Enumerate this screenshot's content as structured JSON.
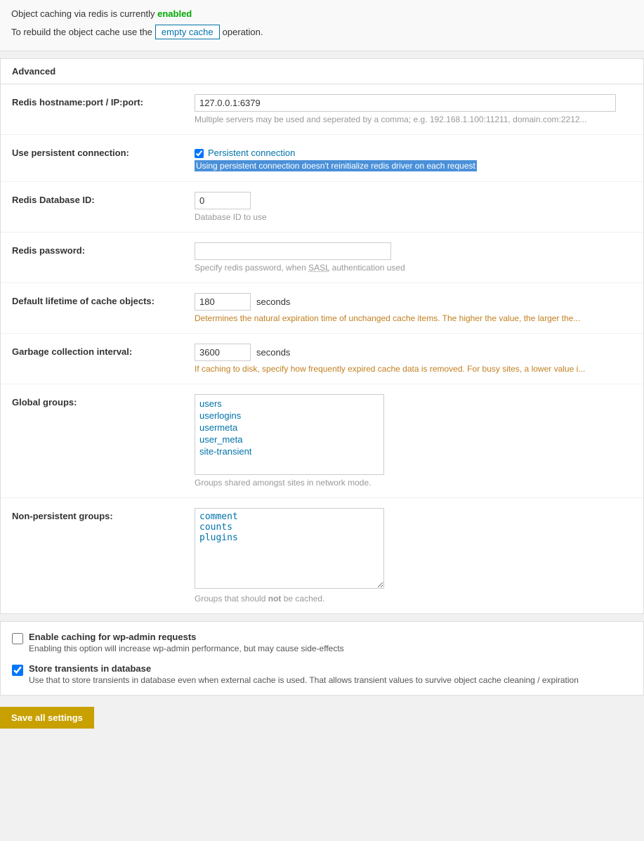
{
  "page": {
    "object_caching_status_prefix": "Object caching via redis is currently",
    "object_caching_status": "enabled",
    "rebuild_prefix": "To rebuild the object cache use the",
    "rebuild_suffix": "operation.",
    "empty_cache_btn": "empty cache"
  },
  "advanced_section": {
    "title": "Advanced",
    "fields": {
      "redis_host": {
        "label": "Redis hostname:port / IP:port:",
        "value": "127.0.0.1:6379",
        "hint": "Multiple servers may be used and seperated by a comma; e.g. 192.168.1.100:11211, domain.com:2212..."
      },
      "persistent_connection": {
        "label": "Use persistent connection:",
        "checkbox_label": "Persistent connection",
        "checked": true,
        "info": "Using persistent connection doesn't reinitialize redis driver on each request"
      },
      "redis_db_id": {
        "label": "Redis Database ID:",
        "value": "0",
        "hint": "Database ID to use"
      },
      "redis_password": {
        "label": "Redis password:",
        "value": "",
        "hint": "Specify redis password, when SASL authentication used"
      },
      "default_lifetime": {
        "label": "Default lifetime of cache objects:",
        "value": "180",
        "unit": "seconds",
        "hint": "Determines the natural expiration time of unchanged cache items. The higher the value, the larger the..."
      },
      "gc_interval": {
        "label": "Garbage collection interval:",
        "value": "3600",
        "unit": "seconds",
        "hint": "If caching to disk, specify how frequently expired cache data is removed. For busy sites, a lower value i..."
      },
      "global_groups": {
        "label": "Global groups:",
        "values": [
          "users",
          "userlogins",
          "usermeta",
          "user_meta",
          "site-transient"
        ],
        "hint": "Groups shared amongst sites in network mode."
      },
      "non_persistent_groups": {
        "label": "Non-persistent groups:",
        "values": [
          "comment",
          "counts",
          "plugins"
        ],
        "hint": "Groups that should not be cached."
      }
    }
  },
  "bottom_options": {
    "enable_wp_admin": {
      "label": "Enable caching for wp-admin requests",
      "checked": false,
      "desc": "Enabling this option will increase wp-admin performance, but may cause side-effects"
    },
    "store_transients": {
      "label": "Store transients in database",
      "checked": true,
      "desc": "Use that to store transients in database even when external cache is used. That allows transient values to survive object cache cleaning / expiration"
    }
  },
  "save_btn": "Save all settings"
}
